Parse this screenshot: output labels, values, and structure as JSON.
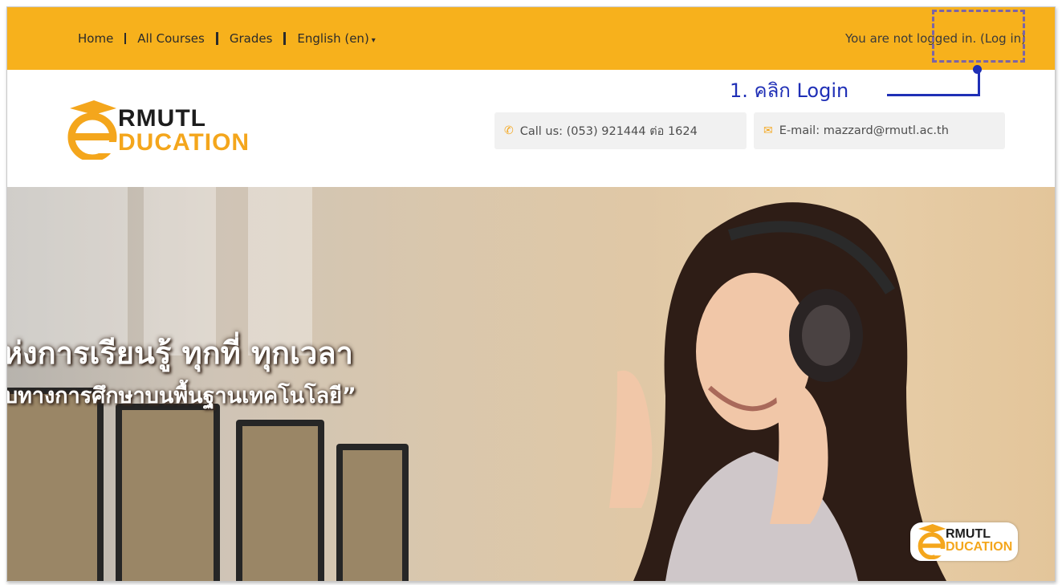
{
  "nav": {
    "home": "Home",
    "all_courses": "All Courses",
    "grades": "Grades",
    "language": "English (en)"
  },
  "login": {
    "prefix": "You are not logged in. (",
    "link": "Log in",
    "suffix": ")"
  },
  "annotation": "1. คลิก Login",
  "logo": {
    "line1": "RMUTL",
    "line2": "DUCATION"
  },
  "contact": {
    "phone": "Call us: (053) 921444 ต่อ 1624",
    "email": "E-mail: mazzard@rmutl.ac.th"
  },
  "hero": {
    "title": "ห่งการเรียนรู้ ทุกที่ ทุกเวลา",
    "subtitle": "บทางการศึกษาบนพื้นฐานเทคโนโลยี”",
    "badge_line1": "RMUTL",
    "badge_line2": "DUCATION"
  },
  "colors": {
    "topbar": "#f7b11c",
    "brand_orange": "#f4a61c",
    "annotation_blue": "#1f2fb6",
    "dash_purple": "#7b64a6"
  }
}
